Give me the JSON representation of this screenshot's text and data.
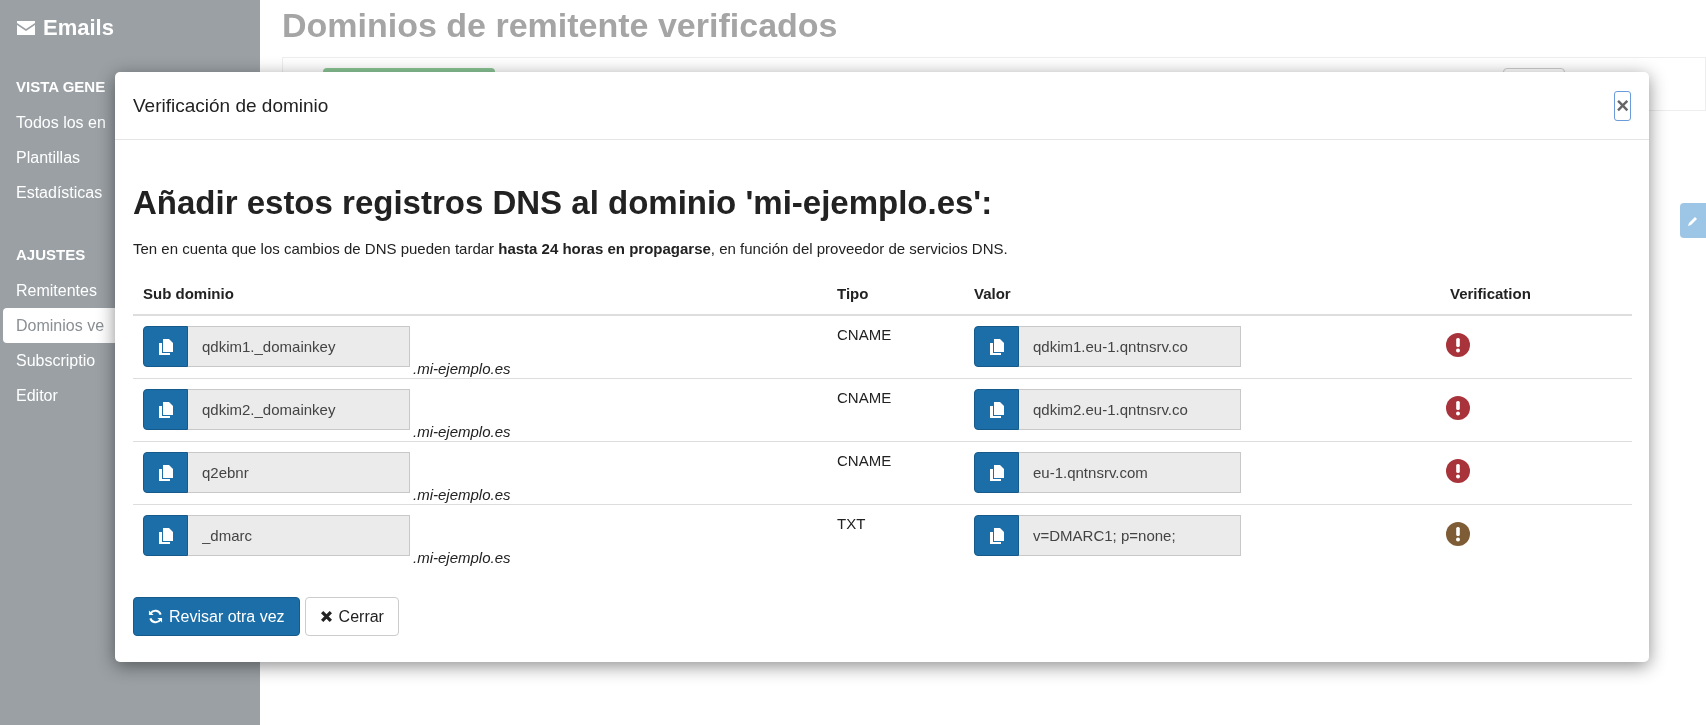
{
  "sidebar": {
    "title": "Emails",
    "sections": [
      {
        "heading": "VISTA GENE",
        "items": [
          {
            "label": "Todos los en",
            "selected": false
          },
          {
            "label": "Plantillas",
            "selected": false
          },
          {
            "label": "Estadísticas",
            "selected": false
          }
        ]
      },
      {
        "heading": "AJUSTES",
        "items": [
          {
            "label": "Remitentes",
            "selected": false
          },
          {
            "label": "Dominios ve",
            "selected": true
          },
          {
            "label": "Subscriptio",
            "selected": false
          },
          {
            "label": "Editor",
            "selected": false
          }
        ]
      }
    ]
  },
  "page": {
    "title": "Dominios de remitente verificados"
  },
  "modal": {
    "title": "Verificación de dominio",
    "close": "×",
    "heading": "Añadir estos registros DNS al dominio 'mi-ejemplo.es':",
    "note": "Ten en cuenta que los cambios de DNS pueden tardar **hasta 24 horas en propagarse**, en función del proveedor de servicios DNS.",
    "columns": [
      "Sub dominio",
      "Tipo",
      "Valor",
      "Verification"
    ],
    "records": [
      {
        "subdomain": "qdkim1._domainkey",
        "suffix": ".mi-ejemplo.es",
        "type": "CNAME",
        "value": "qdkim1.eu-1.qntnsrv.co",
        "color": "#a8333a"
      },
      {
        "subdomain": "qdkim2._domainkey",
        "suffix": ".mi-ejemplo.es",
        "type": "CNAME",
        "value": "qdkim2.eu-1.qntnsrv.co",
        "color": "#a8333a"
      },
      {
        "subdomain": "q2ebnr",
        "suffix": ".mi-ejemplo.es",
        "type": "CNAME",
        "value": "eu-1.qntnsrv.com",
        "color": "#a8333a"
      },
      {
        "subdomain": "_dmarc",
        "suffix": ".mi-ejemplo.es",
        "type": "TXT",
        "value": "v=DMARC1; p=none;",
        "color": "#7e5c35"
      }
    ],
    "buttons": [
      {
        "label": "Revisar otra vez",
        "kind": "primary"
      },
      {
        "label": "Cerrar",
        "kind": "default"
      }
    ]
  }
}
